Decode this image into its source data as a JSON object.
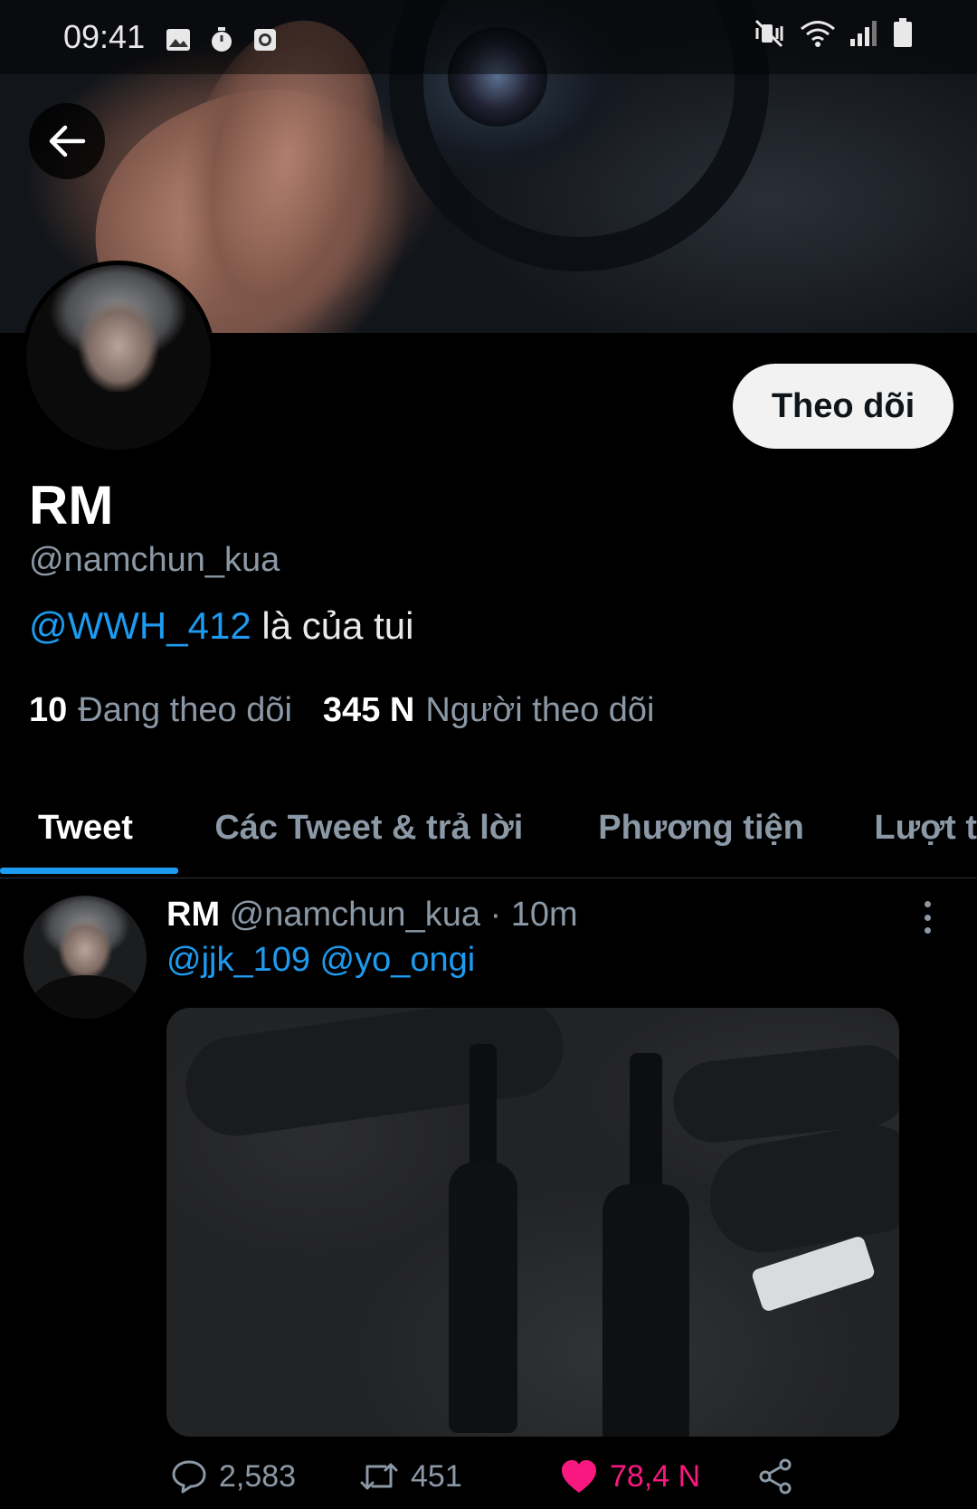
{
  "status_bar": {
    "time": "09:41",
    "left_icons": [
      "image-icon",
      "timer-icon",
      "screen-record-icon"
    ],
    "right_icons": [
      "mute-vibrate-icon",
      "wifi-icon",
      "signal-icon",
      "battery-icon"
    ]
  },
  "profile": {
    "name": "RM",
    "handle": "@namchun_kua",
    "bio_mention": "@WWH_412",
    "bio_text": " là của tui",
    "follow_button": "Theo dõi",
    "following_count": "10",
    "following_label": "Đang theo dõi",
    "followers_count": "345 N",
    "followers_label": "Người theo dõi"
  },
  "tabs": [
    {
      "label": "Tweet",
      "active": true
    },
    {
      "label": "Các Tweet & trả lời",
      "active": false
    },
    {
      "label": "Phương tiện",
      "active": false
    },
    {
      "label": "Lượt t",
      "active": false
    }
  ],
  "tweet": {
    "name": "RM",
    "handle": "@namchun_kua",
    "separator": " · ",
    "time": "10m",
    "text": "@jjk_109 @yo_ongi",
    "replies": "2,583",
    "retweets": "451",
    "likes": "78,4 N"
  },
  "colors": {
    "accent": "#1d9bf0",
    "like": "#f91880",
    "secondary_text": "#8b98a5",
    "background": "#000000"
  }
}
